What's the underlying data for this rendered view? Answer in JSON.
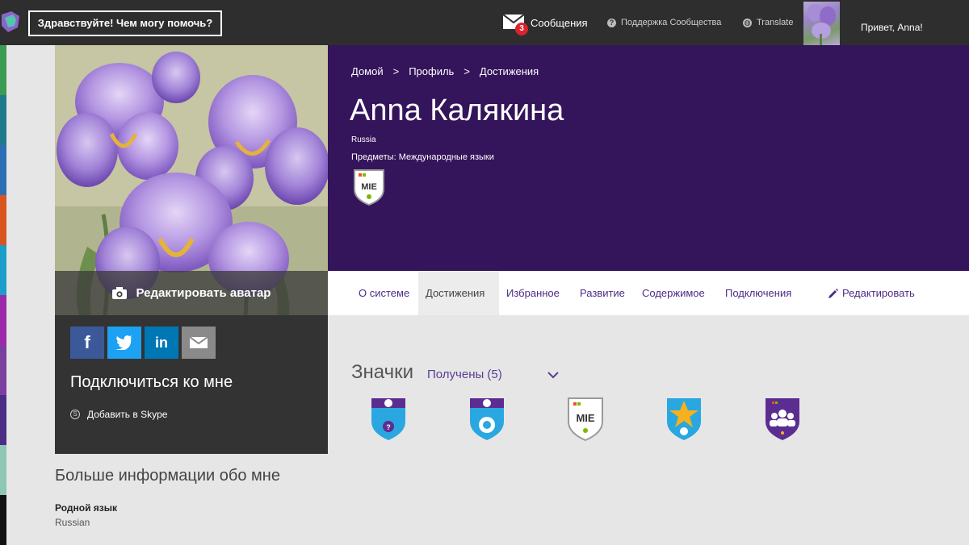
{
  "topbar": {
    "help_button": "Здравствуйте! Чем могу помочь?",
    "messages_label": "Сообщения",
    "messages_count": "3",
    "support_label": "Поддержка Сообщества",
    "translate_label": "Translate",
    "greeting": "Привет, Anna!"
  },
  "profile": {
    "breadcrumbs": [
      "Домой",
      "Профиль",
      "Достижения"
    ],
    "breadcrumb_sep": ">",
    "name": "Anna Калякина",
    "country": "Russia",
    "subjects": "Предметы: Международные языки",
    "edit_avatar": "Редактировать аватар",
    "mie_badge_text": "MIE"
  },
  "tabs": [
    {
      "label": "О системе"
    },
    {
      "label": "Достижения"
    },
    {
      "label": "Избранное"
    },
    {
      "label": "Развитие"
    },
    {
      "label": "Содержимое"
    },
    {
      "label": "Подключения"
    },
    {
      "label": "Редактировать"
    }
  ],
  "social": {
    "title": "Подключиться ко мне",
    "skype": "Добавить в Skype",
    "buttons": [
      {
        "icon": "facebook-icon",
        "glyph": "f",
        "color": "#3b5998"
      },
      {
        "icon": "twitter-icon",
        "color": "#1da1f2"
      },
      {
        "icon": "linkedin-icon",
        "glyph": "in",
        "color": "#0077b5"
      },
      {
        "icon": "mail-icon",
        "color": "#8a8a8a"
      }
    ]
  },
  "about": {
    "title": "Больше информации обо мне",
    "native_language_label": "Родной язык",
    "native_language_value": "Russian"
  },
  "badges": {
    "title": "Значки",
    "filter": "Получены (5)",
    "items": [
      {
        "name": "mystery-skype-badge",
        "color": "#2aa7e0"
      },
      {
        "name": "skype-collaborations-badge",
        "color": "#2aa7e0"
      },
      {
        "name": "certified-mie-badge",
        "color": "#ffffff"
      },
      {
        "name": "skype-star-badge",
        "color": "#2aa7e0"
      },
      {
        "name": "microsoft-community-badge",
        "color": "#5c2d91"
      }
    ]
  },
  "colors": {
    "header": "#34145a",
    "accent": "#5a3c96",
    "topbar": "#2e2e2e"
  }
}
